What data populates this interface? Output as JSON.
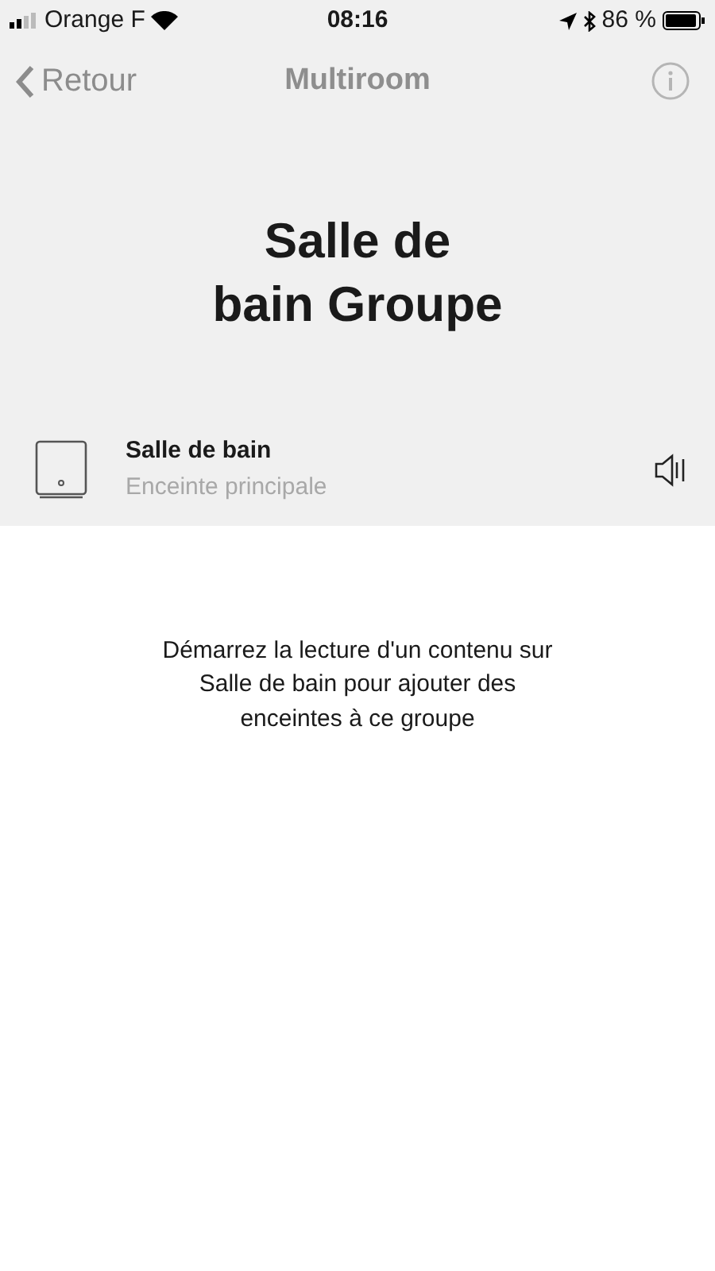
{
  "status_bar": {
    "carrier": "Orange F",
    "time": "08:16",
    "battery": "86 %"
  },
  "nav": {
    "back": {
      "label": "Retour",
      "disabled": true
    },
    "title": "Multiroom"
  },
  "group": {
    "title_lines": [
      "Salle de",
      "bain Groupe"
    ]
  },
  "speakers": [
    {
      "name": "Salle de bain",
      "role": "Enceinte principale"
    }
  ],
  "message_lines": [
    "Démarrez la lecture d'un contenu sur",
    "Salle de bain pour ajouter des",
    "enceintes à ce groupe"
  ]
}
